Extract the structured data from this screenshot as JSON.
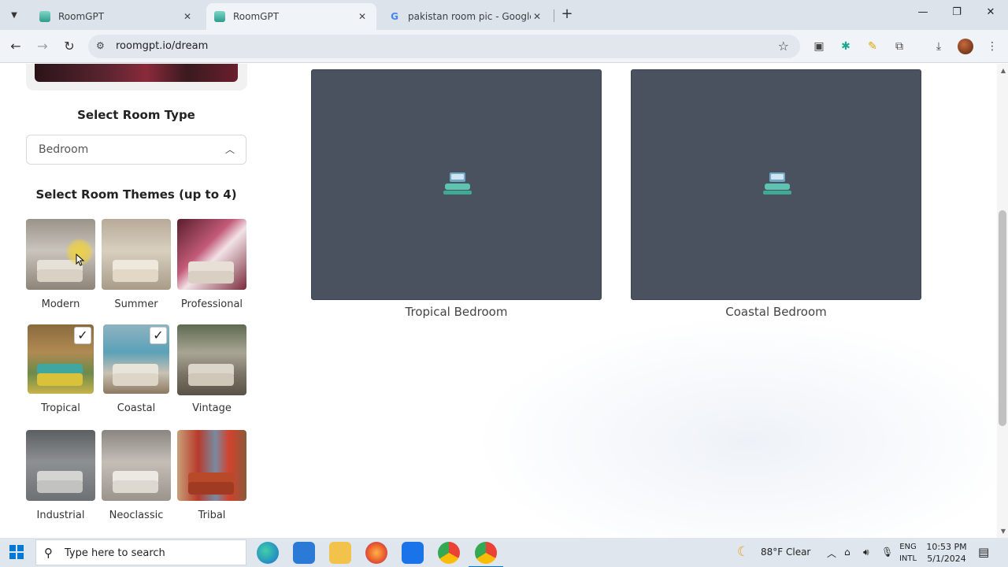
{
  "browser": {
    "tabs": [
      {
        "title": "RoomGPT",
        "favicon": "roomgpt-logo",
        "active": false
      },
      {
        "title": "RoomGPT",
        "favicon": "roomgpt-logo",
        "active": true
      },
      {
        "title": "pakistan room pic - Google Se",
        "favicon": "google-logo",
        "active": false
      }
    ],
    "new_tab_symbol": "+",
    "url": "roomgpt.io/dream",
    "window_controls": {
      "minimize": "—",
      "restore": "❐",
      "close": "✕"
    }
  },
  "sidebar": {
    "room_type_heading": "Select Room Type",
    "room_type_value": "Bedroom",
    "themes_heading": "Select Room Themes (up to 4)",
    "themes": [
      {
        "label": "Modern",
        "selected": false
      },
      {
        "label": "Summer",
        "selected": false
      },
      {
        "label": "Professional",
        "selected": false
      },
      {
        "label": "Tropical",
        "selected": true
      },
      {
        "label": "Coastal",
        "selected": true
      },
      {
        "label": "Vintage",
        "selected": false
      },
      {
        "label": "Industrial",
        "selected": false
      },
      {
        "label": "Neoclassic",
        "selected": false
      },
      {
        "label": "Tribal",
        "selected": false
      }
    ],
    "check_symbol": "✓"
  },
  "results": [
    {
      "label": "Tropical Bedroom",
      "status": "loading"
    },
    {
      "label": "Coastal Bedroom",
      "status": "loading"
    }
  ],
  "taskbar": {
    "search_placeholder": "Type here to search",
    "weather": "88°F  Clear",
    "lang_line1": "ENG",
    "lang_line2": "INTL",
    "time": "10:53 PM",
    "date": "5/1/2024"
  },
  "colors": {
    "card_bg": "#4a5260",
    "loader_teal": "#5ec4b0",
    "tab_bar": "#dde3ea",
    "toolbar": "#f0f4f8"
  }
}
